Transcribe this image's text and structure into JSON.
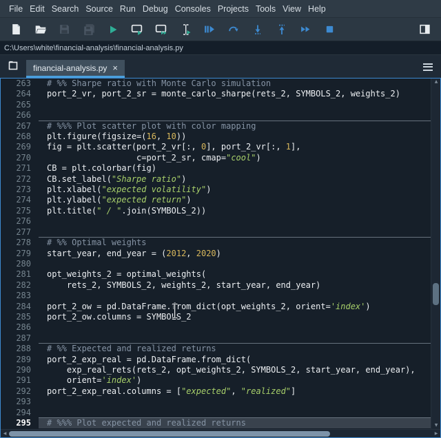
{
  "menu_bar": {
    "items": [
      "File",
      "Edit",
      "Search",
      "Source",
      "Run",
      "Debug",
      "Consoles",
      "Projects",
      "Tools",
      "View",
      "Help"
    ]
  },
  "toolbar": {
    "buttons": [
      {
        "name": "new-file",
        "enabled": true
      },
      {
        "name": "open-file",
        "enabled": true
      },
      {
        "name": "save-file",
        "enabled": false
      },
      {
        "name": "save-all",
        "enabled": false
      },
      {
        "name": "run-file",
        "enabled": true
      },
      {
        "name": "run-cell",
        "enabled": true
      },
      {
        "name": "run-cell-advance",
        "enabled": true
      },
      {
        "name": "run-selection",
        "enabled": true
      },
      {
        "name": "debug-file",
        "enabled": true
      },
      {
        "name": "step-over",
        "enabled": true
      },
      {
        "name": "step-into",
        "enabled": true
      },
      {
        "name": "step-out",
        "enabled": true
      },
      {
        "name": "continue-execution",
        "enabled": true
      },
      {
        "name": "stop-debug",
        "enabled": true
      },
      {
        "name": "maximize-pane",
        "enabled": true
      }
    ]
  },
  "path_bar": {
    "path": "C:\\Users\\white\\financial-analysis\\financial-analysis.py"
  },
  "tab_bar": {
    "tabs": [
      {
        "label": "financial-analysis.py",
        "active": true
      }
    ],
    "close_glyph": "×"
  },
  "colors": {
    "focus_border": "#3d8ad1",
    "tab_underline": "#4a9edb",
    "editor_bg": "#161f29",
    "current_line_bg": "#39424d",
    "text": "#eceff2",
    "comment": "#8694a5",
    "string": "#a8d06a",
    "number": "#d9b85c",
    "run_icon": "#2fae96",
    "debug_icon": "#3d8ad1"
  },
  "scrollbars": {
    "v_up": "▲",
    "v_down": "▼",
    "h_left": "◀",
    "h_right": "▶"
  },
  "editor": {
    "current_line": 295,
    "lines": [
      {
        "n": 263,
        "t": [
          [
            "c",
            "# %% Sharpe ratio with Monte Carlo simulation"
          ]
        ]
      },
      {
        "n": 264,
        "t": [
          [
            "p",
            "port_2_vr, port_2_sr = monte_carlo_sharpe(rets_2, SYMBOLS_2, weights_2)"
          ]
        ]
      },
      {
        "n": 265,
        "t": []
      },
      {
        "n": 266,
        "t": [],
        "sep_after": true
      },
      {
        "n": 267,
        "t": [
          [
            "c",
            "# %%% Plot scatter plot with color mapping"
          ]
        ]
      },
      {
        "n": 268,
        "t": [
          [
            "p",
            "plt.figure(figsize=("
          ],
          [
            "n2",
            "16"
          ],
          [
            "p",
            ", "
          ],
          [
            "n2",
            "10"
          ],
          [
            "p",
            "))"
          ]
        ]
      },
      {
        "n": 269,
        "t": [
          [
            "p",
            "fig = plt.scatter(port_2_vr[:, "
          ],
          [
            "n2",
            "0"
          ],
          [
            "p",
            "], port_2_vr[:, "
          ],
          [
            "n2",
            "1"
          ],
          [
            "p",
            "],"
          ]
        ]
      },
      {
        "n": 270,
        "t": [
          [
            "p",
            "                  c=port_2_sr, cmap="
          ],
          [
            "s",
            "\"cool\""
          ],
          [
            "p",
            ")"
          ]
        ]
      },
      {
        "n": 271,
        "t": [
          [
            "p",
            "CB = plt.colorbar(fig)"
          ]
        ]
      },
      {
        "n": 272,
        "t": [
          [
            "p",
            "CB.set_label("
          ],
          [
            "s",
            "\"Sharpe ratio\""
          ],
          [
            "p",
            ")"
          ]
        ]
      },
      {
        "n": 273,
        "t": [
          [
            "p",
            "plt.xlabel("
          ],
          [
            "s",
            "\"expected volatility\""
          ],
          [
            "p",
            ")"
          ]
        ]
      },
      {
        "n": 274,
        "t": [
          [
            "p",
            "plt.ylabel("
          ],
          [
            "s",
            "\"expected return\""
          ],
          [
            "p",
            ")"
          ]
        ]
      },
      {
        "n": 275,
        "t": [
          [
            "p",
            "plt.title("
          ],
          [
            "s",
            "\" / \""
          ],
          [
            "p",
            ".join(SYMBOLS_2))"
          ]
        ]
      },
      {
        "n": 276,
        "t": []
      },
      {
        "n": 277,
        "t": [],
        "sep_after": true
      },
      {
        "n": 278,
        "t": [
          [
            "c",
            "# %% Optimal weights"
          ]
        ]
      },
      {
        "n": 279,
        "t": [
          [
            "p",
            "start_year, end_year = ("
          ],
          [
            "n2",
            "2012"
          ],
          [
            "p",
            ", "
          ],
          [
            "n2",
            "2020"
          ],
          [
            "p",
            ")"
          ]
        ]
      },
      {
        "n": 280,
        "t": []
      },
      {
        "n": 281,
        "t": [
          [
            "p",
            "opt_weights_2 = optimal_weights("
          ]
        ]
      },
      {
        "n": 282,
        "t": [
          [
            "p",
            "    rets_2, SYMBOLS_2, weights_2, start_year, end_year)"
          ]
        ]
      },
      {
        "n": 283,
        "t": []
      },
      {
        "n": 284,
        "t": [
          [
            "p",
            "port_2_ow = pd.DataFrame.from_dict(opt_weights_2, orient="
          ],
          [
            "s",
            "'index'"
          ],
          [
            "p",
            ")"
          ]
        ]
      },
      {
        "n": 285,
        "t": [
          [
            "p",
            "port_2_ow.columns = SYMBOLS_2"
          ]
        ]
      },
      {
        "n": 286,
        "t": []
      },
      {
        "n": 287,
        "t": [],
        "sep_after": true
      },
      {
        "n": 288,
        "t": [
          [
            "c",
            "# %% Expected and realized returns"
          ]
        ]
      },
      {
        "n": 289,
        "t": [
          [
            "p",
            "port_2_exp_real = pd.DataFrame.from_dict("
          ]
        ]
      },
      {
        "n": 290,
        "t": [
          [
            "p",
            "    exp_real_rets(rets_2, opt_weights_2, SYMBOLS_2, start_year, end_year),"
          ]
        ]
      },
      {
        "n": 291,
        "t": [
          [
            "p",
            "    orient="
          ],
          [
            "s",
            "'index'"
          ],
          [
            "p",
            ")"
          ]
        ]
      },
      {
        "n": 292,
        "t": [
          [
            "p",
            "port_2_exp_real.columns = ["
          ],
          [
            "s",
            "\"expected\""
          ],
          [
            "p",
            ", "
          ],
          [
            "s",
            "\"realized\""
          ],
          [
            "p",
            "]"
          ]
        ]
      },
      {
        "n": 293,
        "t": []
      },
      {
        "n": 294,
        "t": [],
        "sep_after": true
      },
      {
        "n": 295,
        "t": [
          [
            "c",
            "# %%% Plot expected and realized returns"
          ]
        ],
        "current": true
      }
    ]
  }
}
